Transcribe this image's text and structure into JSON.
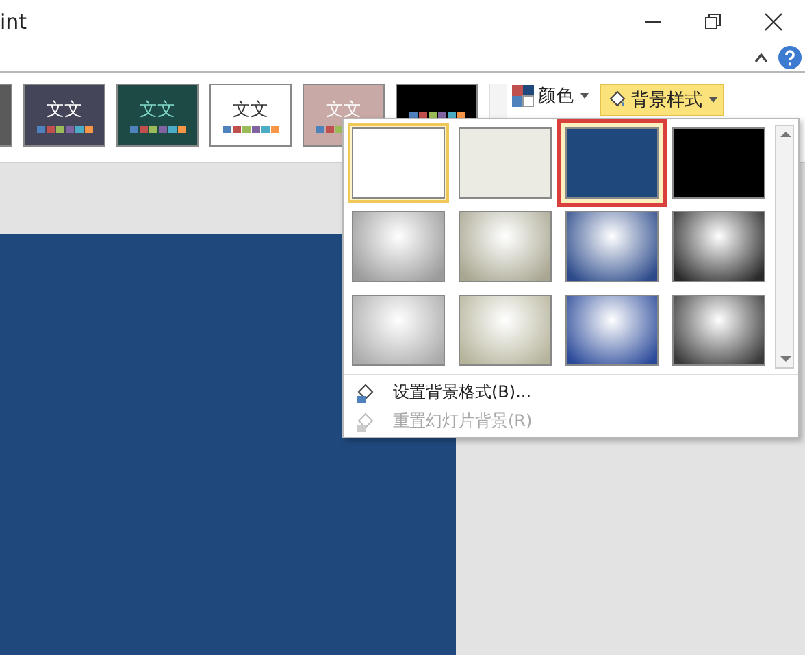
{
  "window": {
    "title": "int"
  },
  "themes": [
    {
      "color": "#5a5a5a"
    },
    {
      "label": "文文",
      "color": "#45455a",
      "kind": "dark"
    },
    {
      "label": "文文",
      "color": "#1d4a44",
      "kind": "teal"
    },
    {
      "label": "文文",
      "color": "#ffffff",
      "kind": "light"
    },
    {
      "label": "文文",
      "color": "#c9a9a6",
      "kind": "dark"
    },
    {
      "color": "#000000"
    }
  ],
  "colors_button": {
    "label": "颜色"
  },
  "background_styles_button": {
    "label": "背景样式",
    "selected": true
  },
  "gallery": [
    {
      "color": "#ffffff",
      "gradient": false,
      "selected": true,
      "highlighted": false
    },
    {
      "color": "#ecebe3",
      "gradient": false,
      "selected": false,
      "highlighted": false
    },
    {
      "color": "#1f497d",
      "gradient": false,
      "selected": false,
      "highlighted": true
    },
    {
      "color": "#000000",
      "gradient": false,
      "selected": false,
      "highlighted": false
    },
    {
      "color": "#9a9a9a",
      "gradient": true,
      "selected": false,
      "highlighted": false
    },
    {
      "color": "#a8a690",
      "gradient": true,
      "selected": false,
      "highlighted": false
    },
    {
      "color": "#2b4a8a",
      "gradient": true,
      "selected": false,
      "highlighted": false
    },
    {
      "color": "#2a2a2a",
      "gradient": true,
      "selected": false,
      "highlighted": false
    },
    {
      "color": "#aaaaaa",
      "gradient": true,
      "selected": false,
      "highlighted": false
    },
    {
      "color": "#b5b39a",
      "gradient": true,
      "selected": false,
      "highlighted": false
    },
    {
      "color": "#2b4a9a",
      "gradient": true,
      "selected": false,
      "highlighted": false
    },
    {
      "color": "#3a3a3a",
      "gradient": true,
      "selected": false,
      "highlighted": false
    }
  ],
  "menu": [
    {
      "label": "设置背景格式(B)...",
      "disabled": false
    },
    {
      "label": "重置幻灯片背景(R)",
      "disabled": true
    }
  ],
  "slide": {
    "color": "#1f497d"
  }
}
